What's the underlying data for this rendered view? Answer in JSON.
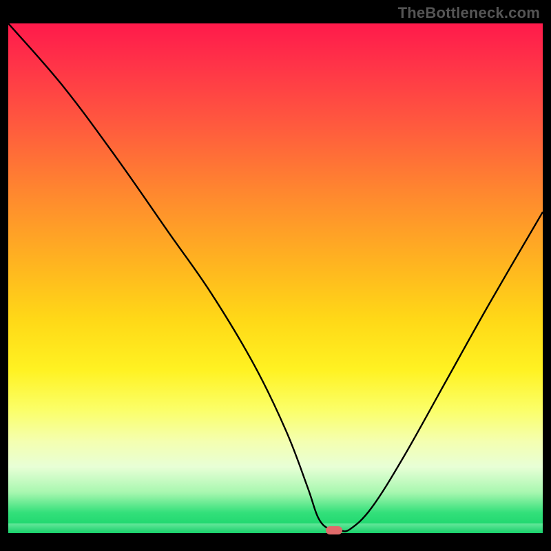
{
  "watermark": "TheBottleneck.com",
  "colors": {
    "marker": "#e06a6a",
    "curve": "#000000"
  },
  "chart_data": {
    "type": "line",
    "title": "",
    "xlabel": "",
    "ylabel": "",
    "xlim": [
      0,
      100
    ],
    "ylim": [
      0,
      100
    ],
    "grid": false,
    "legend": false,
    "series": [
      {
        "name": "bottleneck-curve",
        "x": [
          0,
          10,
          20,
          30,
          38,
          46,
          52,
          56,
          58,
          60,
          62,
          64,
          68,
          74,
          82,
          90,
          100
        ],
        "values": [
          100,
          88,
          74,
          59,
          47,
          33,
          20,
          9,
          3,
          0.8,
          0.5,
          0.8,
          5,
          15,
          30,
          45,
          63
        ]
      }
    ],
    "marker": {
      "x": 61,
      "y": 0.6
    },
    "background_gradient": {
      "type": "vertical",
      "stops": [
        {
          "pos": 0,
          "color": "#ff1a4b"
        },
        {
          "pos": 20,
          "color": "#ff5a3e"
        },
        {
          "pos": 48,
          "color": "#ffb71f"
        },
        {
          "pos": 68,
          "color": "#fff222"
        },
        {
          "pos": 87,
          "color": "#e8ffd6"
        },
        {
          "pos": 100,
          "color": "#12d268"
        }
      ]
    }
  }
}
